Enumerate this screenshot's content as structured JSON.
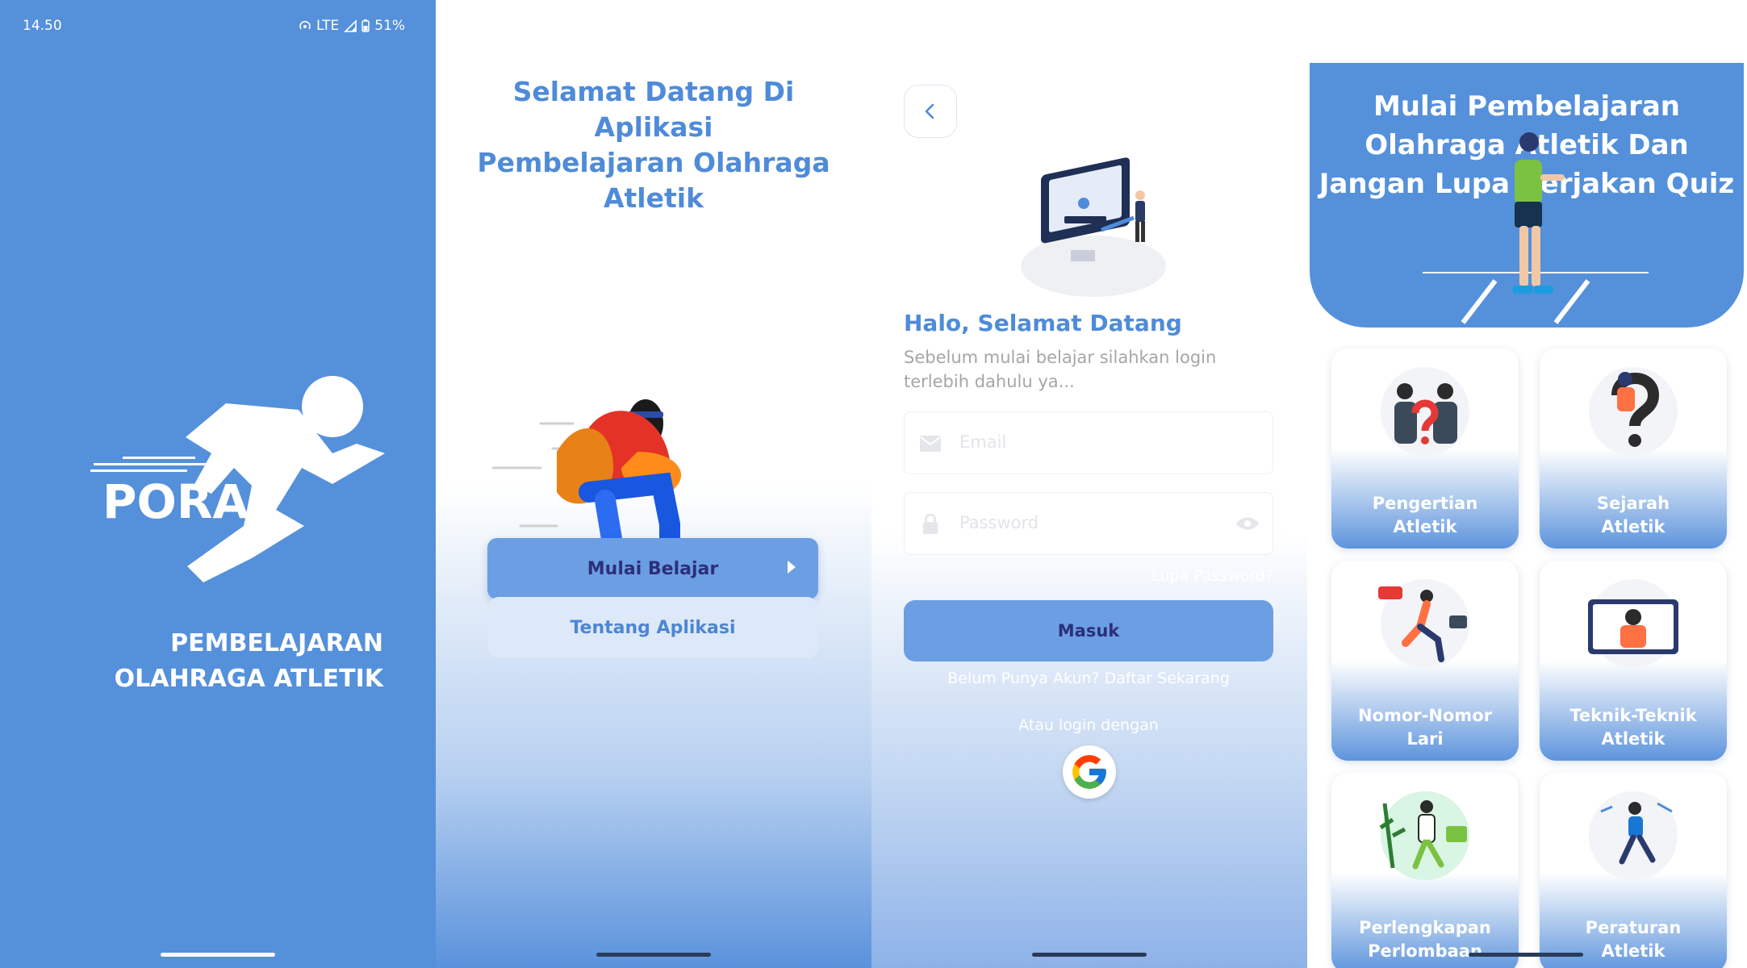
{
  "colors": {
    "primary": "#5590db",
    "button": "#6b9ee3",
    "button_text": "#2c2f7a",
    "title_blue": "#4f8bd8"
  },
  "splash": {
    "status": {
      "time": "14.50",
      "network": "LTE",
      "battery": "51%"
    },
    "logo_text": "PORA",
    "title_line1": "PEMBELAJARAN",
    "title_line2": "OLAHRAGA ATLETIK"
  },
  "welcome": {
    "title_line1": "Selamat Datang Di Aplikasi",
    "title_line2": "Pembelajaran Olahraga",
    "title_line3": "Atletik",
    "start_button": "Mulai Belajar",
    "about_button": "Tentang Aplikasi"
  },
  "login": {
    "greeting": "Halo, Selamat Datang",
    "subtitle_line1": "Sebelum mulai belajar silahkan login",
    "subtitle_line2": "terlebih dahulu ya...",
    "email_placeholder": "Email",
    "password_placeholder": "Password",
    "forgot": "Lupa Password?",
    "submit": "Masuk",
    "register": "Belum Punya Akun? Daftar Sekarang",
    "or_login": "Atau login dengan"
  },
  "home": {
    "hero_line1": "Mulai Pembelajaran",
    "hero_line2": "Olahraga Atletik Dan",
    "hero_line3": "Jangan Lupa Kerjakan Quiz",
    "cards": [
      {
        "line1": "Pengertian",
        "line2": "Atletik"
      },
      {
        "line1": "Sejarah",
        "line2": "Atletik"
      },
      {
        "line1": "Nomor-Nomor",
        "line2": "Lari"
      },
      {
        "line1": "Teknik-Teknik",
        "line2": "Atletik"
      },
      {
        "line1": "Perlengkapan",
        "line2": "Perlombaan"
      },
      {
        "line1": "Peraturan",
        "line2": "Atletik"
      }
    ]
  }
}
